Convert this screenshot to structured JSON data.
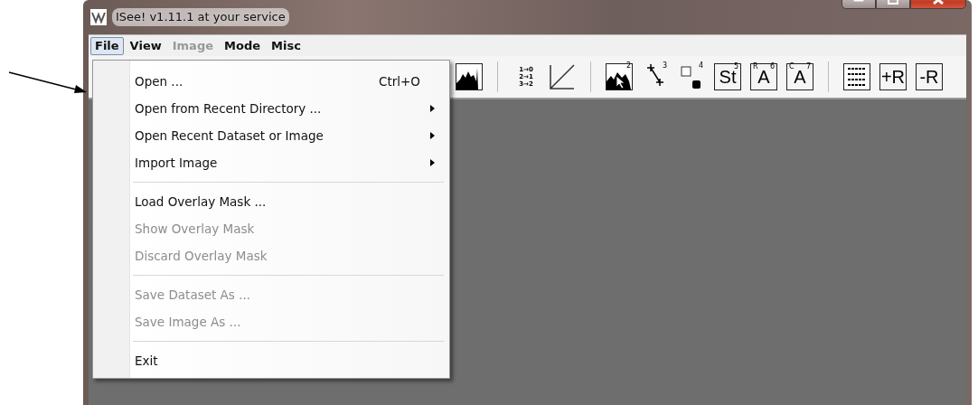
{
  "window": {
    "title": "ISee! v1.11.1 at your service"
  },
  "menubar": [
    {
      "label": "File",
      "selected": true,
      "disabled": false
    },
    {
      "label": "View",
      "selected": false,
      "disabled": false
    },
    {
      "label": "Image",
      "selected": false,
      "disabled": true
    },
    {
      "label": "Mode",
      "selected": false,
      "disabled": false
    },
    {
      "label": "Misc",
      "selected": false,
      "disabled": false
    }
  ],
  "toolbar": [
    {
      "kind": "histogram"
    },
    {
      "kind": "separator"
    },
    {
      "kind": "mapping",
      "lines": [
        "1→0",
        "2→1",
        "3→2"
      ]
    },
    {
      "kind": "diagonal"
    },
    {
      "kind": "separator"
    },
    {
      "kind": "histogram-cursor",
      "sup": "2"
    },
    {
      "kind": "line-tool",
      "sup": "3"
    },
    {
      "kind": "point-tool",
      "sup": "4"
    },
    {
      "kind": "text",
      "text": "St",
      "sup": "5"
    },
    {
      "kind": "text",
      "text": "A",
      "sup": "6",
      "corner": "R"
    },
    {
      "kind": "text",
      "text": "A",
      "sup": "7",
      "corner": "C"
    },
    {
      "kind": "separator"
    },
    {
      "kind": "list"
    },
    {
      "kind": "text",
      "text": "+R"
    },
    {
      "kind": "text",
      "text": "-R"
    }
  ],
  "file_menu": [
    {
      "kind": "item",
      "label": "Open ...",
      "shortcut": "Ctrl+O",
      "submenu": false,
      "disabled": false
    },
    {
      "kind": "item",
      "label": "Open from Recent Directory ...",
      "submenu": true,
      "disabled": false
    },
    {
      "kind": "item",
      "label": "Open Recent Dataset or Image",
      "submenu": true,
      "disabled": false
    },
    {
      "kind": "item",
      "label": "Import Image",
      "submenu": true,
      "disabled": false
    },
    {
      "kind": "separator"
    },
    {
      "kind": "item",
      "label": "Load Overlay Mask ...",
      "submenu": false,
      "disabled": false
    },
    {
      "kind": "item",
      "label": "Show Overlay Mask",
      "submenu": false,
      "disabled": true
    },
    {
      "kind": "item",
      "label": "Discard Overlay Mask",
      "submenu": false,
      "disabled": true
    },
    {
      "kind": "separator"
    },
    {
      "kind": "item",
      "label": "Save Dataset As ...",
      "submenu": false,
      "disabled": true
    },
    {
      "kind": "item",
      "label": "Save Image As ...",
      "submenu": false,
      "disabled": true
    },
    {
      "kind": "separator"
    },
    {
      "kind": "item",
      "label": "Exit",
      "submenu": false,
      "disabled": false
    }
  ]
}
